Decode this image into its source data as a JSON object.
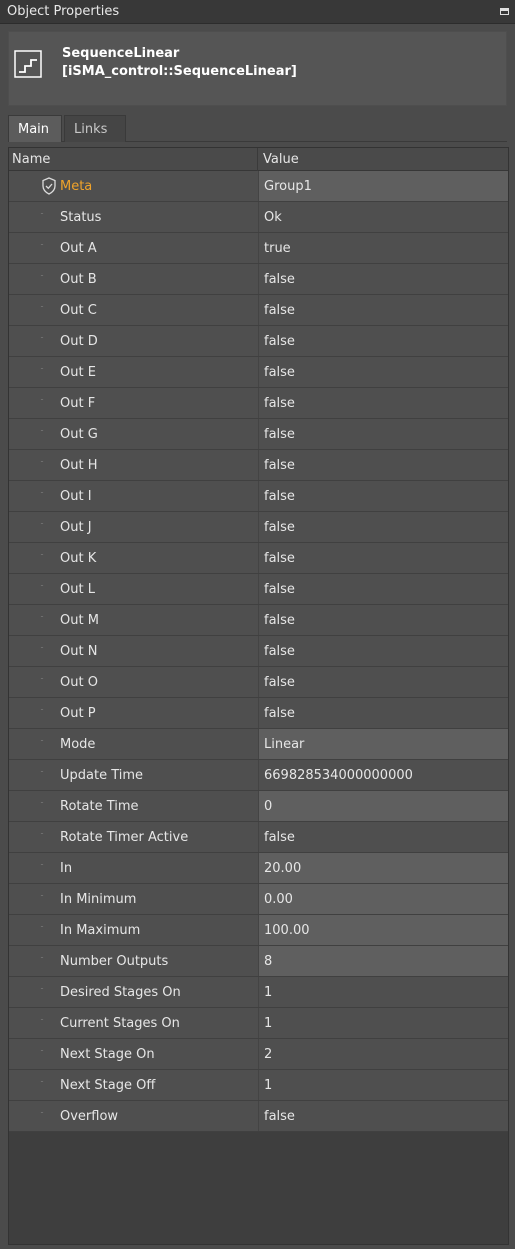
{
  "window": {
    "title": "Object Properties"
  },
  "object": {
    "name": "SequenceLinear",
    "type": "[iSMA_control::SequenceLinear]",
    "icon": "sequence-stairs-icon"
  },
  "tabs": [
    {
      "label": "Main",
      "active": true
    },
    {
      "label": "Links",
      "active": false
    }
  ],
  "table": {
    "headers": {
      "name": "Name",
      "value": "Value"
    },
    "rows": [
      {
        "name": "Meta",
        "value": "Group1",
        "icon": "shield-icon",
        "editable": true,
        "meta": true
      },
      {
        "name": "Status",
        "value": "Ok",
        "icon": "slot-icon",
        "editable": false
      },
      {
        "name": "Out A",
        "value": "true",
        "icon": "slot-icon",
        "editable": false
      },
      {
        "name": "Out B",
        "value": "false",
        "icon": "slot-icon",
        "editable": false
      },
      {
        "name": "Out C",
        "value": "false",
        "icon": "slot-icon",
        "editable": false
      },
      {
        "name": "Out D",
        "value": "false",
        "icon": "slot-icon",
        "editable": false
      },
      {
        "name": "Out E",
        "value": "false",
        "icon": "slot-icon",
        "editable": false
      },
      {
        "name": "Out F",
        "value": "false",
        "icon": "slot-icon",
        "editable": false
      },
      {
        "name": "Out G",
        "value": "false",
        "icon": "slot-icon",
        "editable": false
      },
      {
        "name": "Out H",
        "value": "false",
        "icon": "slot-icon",
        "editable": false
      },
      {
        "name": "Out I",
        "value": "false",
        "icon": "slot-icon",
        "editable": false
      },
      {
        "name": "Out J",
        "value": "false",
        "icon": "slot-icon",
        "editable": false
      },
      {
        "name": "Out K",
        "value": "false",
        "icon": "slot-icon",
        "editable": false
      },
      {
        "name": "Out L",
        "value": "false",
        "icon": "slot-icon",
        "editable": false
      },
      {
        "name": "Out M",
        "value": "false",
        "icon": "slot-icon",
        "editable": false
      },
      {
        "name": "Out N",
        "value": "false",
        "icon": "slot-icon",
        "editable": false
      },
      {
        "name": "Out O",
        "value": "false",
        "icon": "slot-icon",
        "editable": false
      },
      {
        "name": "Out P",
        "value": "false",
        "icon": "slot-icon",
        "editable": false
      },
      {
        "name": "Mode",
        "value": "Linear",
        "icon": "slot-icon",
        "editable": true
      },
      {
        "name": "Update Time",
        "value": "669828534000000000",
        "icon": "slot-icon",
        "editable": false
      },
      {
        "name": "Rotate Time",
        "value": "0",
        "icon": "slot-icon",
        "editable": true
      },
      {
        "name": "Rotate Timer Active",
        "value": "false",
        "icon": "slot-icon",
        "editable": false
      },
      {
        "name": "In",
        "value": "20.00",
        "icon": "slot-icon",
        "editable": true
      },
      {
        "name": "In Minimum",
        "value": "0.00",
        "icon": "slot-icon",
        "editable": true
      },
      {
        "name": "In Maximum",
        "value": "100.00",
        "icon": "slot-icon",
        "editable": true
      },
      {
        "name": "Number Outputs",
        "value": "8",
        "icon": "slot-icon",
        "editable": true
      },
      {
        "name": "Desired Stages On",
        "value": "1",
        "icon": "slot-icon",
        "editable": false
      },
      {
        "name": "Current Stages On",
        "value": "1",
        "icon": "slot-icon",
        "editable": false
      },
      {
        "name": "Next Stage On",
        "value": "2",
        "icon": "slot-icon",
        "editable": false
      },
      {
        "name": "Next Stage Off",
        "value": "1",
        "icon": "slot-icon",
        "editable": false
      },
      {
        "name": "Overflow",
        "value": "false",
        "icon": "slot-icon",
        "editable": false
      }
    ]
  },
  "colors": {
    "background": "#4b4b4b",
    "meta_label": "#f0a32a",
    "editable_value_bg": "#5f5f5f",
    "readonly_value_bg": "#4f4f4f"
  }
}
